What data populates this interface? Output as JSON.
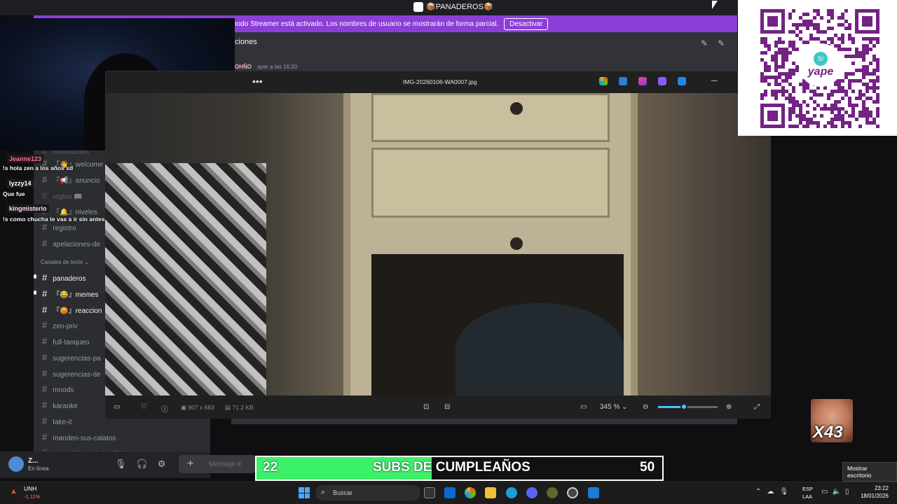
{
  "window": {
    "title": "📦PANADEROS📦"
  },
  "banner": {
    "text": "El modo Streamer está activado. Los nombres de usuario se mostrarán de forma parcial.",
    "button": "Desactivar"
  },
  "channel": {
    "header": "ciones",
    "message_author": "OHÑO",
    "message_time": "ayer a las 16:20"
  },
  "sidebar": {
    "category": "Canales de texto ⌄",
    "channels": [
      {
        "label": "información",
        "faded": true
      },
      {
        "label": "『👋』welcome",
        "faded": false
      },
      {
        "label": "『📢』anuncio",
        "faded": false
      },
      {
        "label": "reglas 📖",
        "faded": true
      },
      {
        "label": "『🔔』niveles",
        "faded": false
      },
      {
        "label": "registro",
        "faded": false
      },
      {
        "label": "apelaciones-de",
        "faded": false
      },
      {
        "label": "panaderos",
        "faded": false
      },
      {
        "label": "『😂』memes",
        "faded": false
      },
      {
        "label": "『😡』reaccion",
        "faded": false
      },
      {
        "label": "zen-priv",
        "faded": false
      },
      {
        "label": "full-tanqueo",
        "faded": false
      },
      {
        "label": "sugerencias-pa",
        "faded": false
      },
      {
        "label": "sugerencias-de",
        "faded": false
      },
      {
        "label": "moods",
        "faded": false
      },
      {
        "label": "karaoke",
        "faded": false
      },
      {
        "label": "take-it",
        "faded": false
      },
      {
        "label": "manden-sus-calatos",
        "faded": false
      },
      {
        "label": "preguntas-para-tarotistas",
        "faded": false
      }
    ]
  },
  "user_panel": {
    "name": "Z...",
    "status": "En línea"
  },
  "composer": {
    "placeholder": "Mensaje #"
  },
  "chat": [
    {
      "user": "Jeanne123",
      "message": "!s hola zen a los años xd",
      "user_color": "#ff6b8a"
    },
    {
      "user": "lyzzy14",
      "message": "Que fue",
      "user_color": "#ffffff"
    },
    {
      "user": "kingmisterio",
      "message": "!s como chucha te vas a ir sin antes mostrar la cagada de foto por la que pagaste",
      "user_color": "#ffd6f0"
    }
  ],
  "viewer": {
    "filename": "IMG-20260106-WA0007.jpg",
    "menu": "•••",
    "dimensions": "907 x 683",
    "filesize": "71.2 KB",
    "zoom": "345 %",
    "zoom_fraction": 0.44
  },
  "qr": {
    "brand": "yape",
    "badge": "S/"
  },
  "emote": {
    "count": "X43"
  },
  "subs": {
    "current": "22",
    "title": "SUBS DE CUMPLEAÑOS",
    "goal": "50"
  },
  "tooltip": {
    "text": "Mostrar escritorio"
  },
  "taskbar": {
    "stock_name": "UNH",
    "stock_change": "-1.11%",
    "search": "Buscar",
    "lang_top": "ESP",
    "lang_bottom": "LAA",
    "time": "23:22",
    "date": "18/01/2026"
  },
  "colors": {
    "banner": "#8c3fd6",
    "subs_fill": "#3cf06a",
    "qr_purple": "#742284",
    "accent": "#4cc2ff"
  }
}
